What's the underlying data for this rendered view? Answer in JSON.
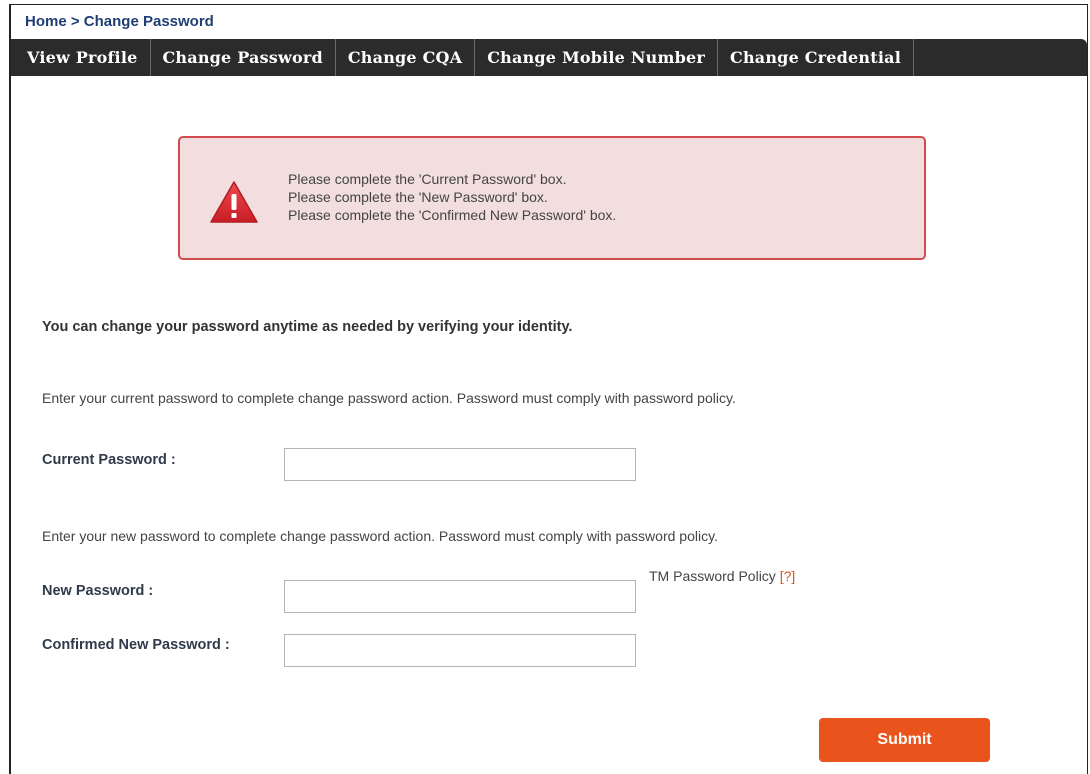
{
  "breadcrumb": {
    "home": "Home",
    "separator": ">",
    "current": "Change Password"
  },
  "tabs": [
    {
      "label": "View Profile"
    },
    {
      "label": "Change Password"
    },
    {
      "label": "Change CQA"
    },
    {
      "label": "Change Mobile Number"
    },
    {
      "label": "Change Credential"
    }
  ],
  "alert": {
    "icon": "warning-icon",
    "messages": [
      "Please complete the 'Current Password' box.",
      "Please complete the 'New Password' box.",
      "Please complete the 'Confirmed New Password' box."
    ],
    "colors": {
      "background": "#f2dede",
      "border": "#d04b4b",
      "icon": "#d9262c"
    }
  },
  "form": {
    "intro": "You can change your password anytime as needed by verifying your identity.",
    "current_hint": "Enter your current password to complete change password action. Password must comply with password policy.",
    "current_label": "Current Password :",
    "current_value": "",
    "new_hint": "Enter your new password to complete change password action. Password must comply with password policy.",
    "policy_label": "TM Password Policy",
    "policy_help": "[?]",
    "new_label": "New Password :",
    "new_value": "",
    "confirm_label": "Confirmed New Password :",
    "confirm_value": "",
    "submit_label": "Submit"
  },
  "colors": {
    "tab_bar": "#2b2b2b",
    "accent": "#e8541b",
    "breadcrumb": "#1f3f74"
  }
}
